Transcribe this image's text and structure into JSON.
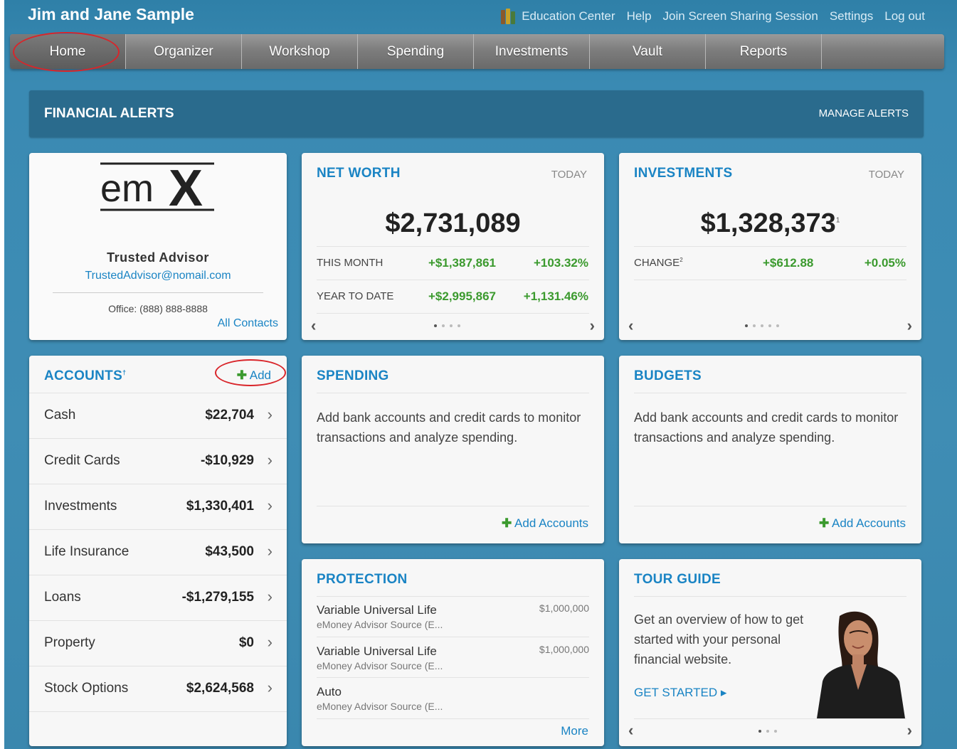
{
  "header": {
    "household_name": "Jim and Jane Sample",
    "links": {
      "education_center": "Education Center",
      "help": "Help",
      "screen_sharing": "Join Screen Sharing Session",
      "settings": "Settings",
      "logout": "Log out"
    }
  },
  "nav": {
    "tabs": [
      "Home",
      "Organizer",
      "Workshop",
      "Spending",
      "Investments",
      "Vault",
      "Reports"
    ],
    "active": "Home"
  },
  "alerts": {
    "title": "FINANCIAL ALERTS",
    "manage": "MANAGE ALERTS"
  },
  "advisor": {
    "logo_text": "emX",
    "name": "Trusted Advisor",
    "email": "TrustedAdvisor@nomail.com",
    "office": "Office: (888) 888-8888",
    "all_contacts": "All Contacts"
  },
  "net_worth": {
    "title": "NET WORTH",
    "when": "TODAY",
    "value": "$2,731,089",
    "rows": [
      {
        "label": "THIS MONTH",
        "amount": "+$1,387,861",
        "pct": "+103.32%"
      },
      {
        "label": "YEAR TO DATE",
        "amount": "+$2,995,867",
        "pct": "+1,131.46%"
      }
    ]
  },
  "investments": {
    "title": "INVESTMENTS",
    "when": "TODAY",
    "value": "$1,328,373",
    "footnote": "1",
    "change_label": "CHANGE",
    "change_footnote": "2",
    "change_amount": "+$612.88",
    "change_pct": "+0.05%"
  },
  "accounts": {
    "title": "ACCOUNTS",
    "footnote": "†",
    "add": "Add",
    "rows": [
      {
        "label": "Cash",
        "value": "$22,704"
      },
      {
        "label": "Credit Cards",
        "value": "-$10,929"
      },
      {
        "label": "Investments",
        "value": "$1,330,401"
      },
      {
        "label": "Life Insurance",
        "value": "$43,500"
      },
      {
        "label": "Loans",
        "value": "-$1,279,155"
      },
      {
        "label": "Property",
        "value": "$0"
      },
      {
        "label": "Stock Options",
        "value": "$2,624,568"
      }
    ]
  },
  "spending": {
    "title": "SPENDING",
    "text": "Add bank accounts and credit cards to monitor transactions and analyze spending.",
    "add": "Add Accounts"
  },
  "budgets": {
    "title": "BUDGETS",
    "text": "Add bank accounts and credit cards to monitor transactions and analyze spending.",
    "add": "Add Accounts"
  },
  "protection": {
    "title": "PROTECTION",
    "items": [
      {
        "name": "Variable Universal Life",
        "source": "eMoney Advisor Source (E...",
        "amount": "$1,000,000"
      },
      {
        "name": "Variable Universal Life",
        "source": "eMoney Advisor Source (E...",
        "amount": "$1,000,000"
      },
      {
        "name": "Auto",
        "source": "eMoney Advisor Source (E...",
        "amount": ""
      }
    ],
    "more": "More"
  },
  "tour": {
    "title": "TOUR GUIDE",
    "text": "Get an overview of how to get started with your personal financial website.",
    "cta": "GET STARTED ▸"
  },
  "colors": {
    "accent": "#1a84c4",
    "positive": "#3b9a2e",
    "highlight_circle": "#d9252a"
  }
}
